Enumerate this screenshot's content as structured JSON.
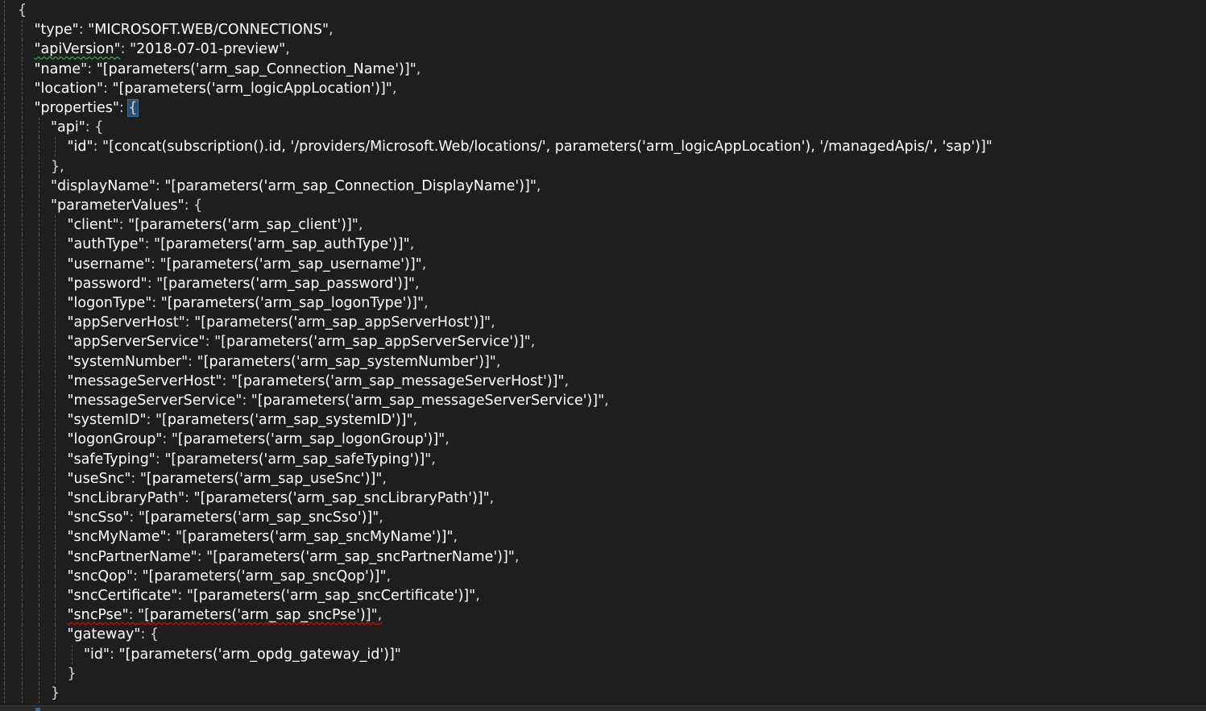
{
  "editor": {
    "lines": [
      {
        "indent": 0,
        "segments": [
          {
            "t": "{",
            "c": "punc"
          }
        ]
      },
      {
        "indent": 1,
        "segments": [
          {
            "t": "\"type\"",
            "c": "key"
          },
          {
            "t": ": ",
            "c": "punc"
          },
          {
            "t": "\"MICROSOFT.WEB/CONNECTIONS\"",
            "c": "str"
          },
          {
            "t": ",",
            "c": "punc"
          }
        ]
      },
      {
        "indent": 1,
        "segments": [
          {
            "t": "\"apiVersion\"",
            "c": "key",
            "sq": "green"
          },
          {
            "t": ": ",
            "c": "punc"
          },
          {
            "t": "\"2018-07-01-preview\"",
            "c": "str"
          },
          {
            "t": ",",
            "c": "punc"
          }
        ]
      },
      {
        "indent": 1,
        "segments": [
          {
            "t": "\"name\"",
            "c": "key"
          },
          {
            "t": ": ",
            "c": "punc"
          },
          {
            "t": "\"[parameters('arm_sap_Connection_Name')]\"",
            "c": "str"
          },
          {
            "t": ",",
            "c": "punc"
          }
        ]
      },
      {
        "indent": 1,
        "segments": [
          {
            "t": "\"location\"",
            "c": "key"
          },
          {
            "t": ": ",
            "c": "punc"
          },
          {
            "t": "\"[parameters('arm_logicAppLocation')]\"",
            "c": "str"
          },
          {
            "t": ",",
            "c": "punc"
          }
        ]
      },
      {
        "indent": 1,
        "segments": [
          {
            "t": "\"properties\"",
            "c": "key"
          },
          {
            "t": ": ",
            "c": "punc"
          },
          {
            "t": "{",
            "c": "punc",
            "hl": true
          }
        ]
      },
      {
        "indent": 2,
        "segments": [
          {
            "t": "\"api\"",
            "c": "key"
          },
          {
            "t": ": {",
            "c": "punc"
          }
        ]
      },
      {
        "indent": 3,
        "segments": [
          {
            "t": "\"id\"",
            "c": "key"
          },
          {
            "t": ": ",
            "c": "punc"
          },
          {
            "t": "\"[concat(subscription().id, '/providers/Microsoft.Web/locations/', parameters('arm_logicAppLocation'), '/managedApis/', 'sap')]\"",
            "c": "str"
          }
        ]
      },
      {
        "indent": 2,
        "segments": [
          {
            "t": "},",
            "c": "punc"
          }
        ]
      },
      {
        "indent": 2,
        "segments": [
          {
            "t": "\"displayName\"",
            "c": "key"
          },
          {
            "t": ": ",
            "c": "punc"
          },
          {
            "t": "\"[parameters('arm_sap_Connection_DisplayName')]\"",
            "c": "str"
          },
          {
            "t": ",",
            "c": "punc"
          }
        ]
      },
      {
        "indent": 2,
        "segments": [
          {
            "t": "\"parameterValues\"",
            "c": "key"
          },
          {
            "t": ": {",
            "c": "punc"
          }
        ]
      },
      {
        "indent": 3,
        "segments": [
          {
            "t": "\"client\"",
            "c": "key"
          },
          {
            "t": ": ",
            "c": "punc"
          },
          {
            "t": "\"[parameters('arm_sap_client')]\"",
            "c": "str"
          },
          {
            "t": ",",
            "c": "punc"
          }
        ]
      },
      {
        "indent": 3,
        "segments": [
          {
            "t": "\"authType\"",
            "c": "key"
          },
          {
            "t": ": ",
            "c": "punc"
          },
          {
            "t": "\"[parameters('arm_sap_authType')]\"",
            "c": "str"
          },
          {
            "t": ",",
            "c": "punc"
          }
        ]
      },
      {
        "indent": 3,
        "segments": [
          {
            "t": "\"username\"",
            "c": "key"
          },
          {
            "t": ": ",
            "c": "punc"
          },
          {
            "t": "\"[parameters('arm_sap_username')]\"",
            "c": "str"
          },
          {
            "t": ",",
            "c": "punc"
          }
        ]
      },
      {
        "indent": 3,
        "segments": [
          {
            "t": "\"password\"",
            "c": "key"
          },
          {
            "t": ": ",
            "c": "punc"
          },
          {
            "t": "\"[parameters('arm_sap_password')]\"",
            "c": "str"
          },
          {
            "t": ",",
            "c": "punc"
          }
        ]
      },
      {
        "indent": 3,
        "segments": [
          {
            "t": "\"logonType\"",
            "c": "key"
          },
          {
            "t": ": ",
            "c": "punc"
          },
          {
            "t": "\"[parameters('arm_sap_logonType')]\"",
            "c": "str"
          },
          {
            "t": ",",
            "c": "punc"
          }
        ]
      },
      {
        "indent": 3,
        "segments": [
          {
            "t": "\"appServerHost\"",
            "c": "key"
          },
          {
            "t": ": ",
            "c": "punc"
          },
          {
            "t": "\"[parameters('arm_sap_appServerHost')]\"",
            "c": "str"
          },
          {
            "t": ",",
            "c": "punc"
          }
        ]
      },
      {
        "indent": 3,
        "segments": [
          {
            "t": "\"appServerService\"",
            "c": "key"
          },
          {
            "t": ": ",
            "c": "punc"
          },
          {
            "t": "\"[parameters('arm_sap_appServerService')]\"",
            "c": "str"
          },
          {
            "t": ",",
            "c": "punc"
          }
        ]
      },
      {
        "indent": 3,
        "segments": [
          {
            "t": "\"systemNumber\"",
            "c": "key"
          },
          {
            "t": ": ",
            "c": "punc"
          },
          {
            "t": "\"[parameters('arm_sap_systemNumber')]\"",
            "c": "str"
          },
          {
            "t": ",",
            "c": "punc"
          }
        ]
      },
      {
        "indent": 3,
        "segments": [
          {
            "t": "\"messageServerHost\"",
            "c": "key"
          },
          {
            "t": ": ",
            "c": "punc"
          },
          {
            "t": "\"[parameters('arm_sap_messageServerHost')]\"",
            "c": "str"
          },
          {
            "t": ",",
            "c": "punc"
          }
        ]
      },
      {
        "indent": 3,
        "segments": [
          {
            "t": "\"messageServerService\"",
            "c": "key"
          },
          {
            "t": ": ",
            "c": "punc"
          },
          {
            "t": "\"[parameters('arm_sap_messageServerService')]\"",
            "c": "str"
          },
          {
            "t": ",",
            "c": "punc"
          }
        ]
      },
      {
        "indent": 3,
        "segments": [
          {
            "t": "\"systemID\"",
            "c": "key"
          },
          {
            "t": ": ",
            "c": "punc"
          },
          {
            "t": "\"[parameters('arm_sap_systemID')]\"",
            "c": "str"
          },
          {
            "t": ",",
            "c": "punc"
          }
        ]
      },
      {
        "indent": 3,
        "segments": [
          {
            "t": "\"logonGroup\"",
            "c": "key"
          },
          {
            "t": ": ",
            "c": "punc"
          },
          {
            "t": "\"[parameters('arm_sap_logonGroup')]\"",
            "c": "str"
          },
          {
            "t": ",",
            "c": "punc"
          }
        ]
      },
      {
        "indent": 3,
        "segments": [
          {
            "t": "\"safeTyping\"",
            "c": "key"
          },
          {
            "t": ": ",
            "c": "punc"
          },
          {
            "t": "\"[parameters('arm_sap_safeTyping')]\"",
            "c": "str"
          },
          {
            "t": ",",
            "c": "punc"
          }
        ]
      },
      {
        "indent": 3,
        "segments": [
          {
            "t": "\"useSnc\"",
            "c": "key"
          },
          {
            "t": ": ",
            "c": "punc"
          },
          {
            "t": "\"[parameters('arm_sap_useSnc')]\"",
            "c": "str"
          },
          {
            "t": ",",
            "c": "punc"
          }
        ]
      },
      {
        "indent": 3,
        "segments": [
          {
            "t": "\"sncLibraryPath\"",
            "c": "key"
          },
          {
            "t": ": ",
            "c": "punc"
          },
          {
            "t": "\"[parameters('arm_sap_sncLibraryPath')]\"",
            "c": "str"
          },
          {
            "t": ",",
            "c": "punc"
          }
        ]
      },
      {
        "indent": 3,
        "segments": [
          {
            "t": "\"sncSso\"",
            "c": "key"
          },
          {
            "t": ": ",
            "c": "punc"
          },
          {
            "t": "\"[parameters('arm_sap_sncSso')]\"",
            "c": "str"
          },
          {
            "t": ",",
            "c": "punc"
          }
        ]
      },
      {
        "indent": 3,
        "segments": [
          {
            "t": "\"sncMyName\"",
            "c": "key"
          },
          {
            "t": ": ",
            "c": "punc"
          },
          {
            "t": "\"[parameters('arm_sap_sncMyName')]\"",
            "c": "str"
          },
          {
            "t": ",",
            "c": "punc"
          }
        ]
      },
      {
        "indent": 3,
        "segments": [
          {
            "t": "\"sncPartnerName\"",
            "c": "key"
          },
          {
            "t": ": ",
            "c": "punc"
          },
          {
            "t": "\"[parameters('arm_sap_sncPartnerName')]\"",
            "c": "str"
          },
          {
            "t": ",",
            "c": "punc"
          }
        ]
      },
      {
        "indent": 3,
        "segments": [
          {
            "t": "\"sncQop\"",
            "c": "key"
          },
          {
            "t": ": ",
            "c": "punc"
          },
          {
            "t": "\"[parameters('arm_sap_sncQop')]\"",
            "c": "str"
          },
          {
            "t": ",",
            "c": "punc"
          }
        ]
      },
      {
        "indent": 3,
        "segments": [
          {
            "t": "\"sncCertificate\"",
            "c": "key"
          },
          {
            "t": ": ",
            "c": "punc"
          },
          {
            "t": "\"[parameters('arm_sap_sncCertificate')]\"",
            "c": "str"
          },
          {
            "t": ",",
            "c": "punc"
          }
        ]
      },
      {
        "indent": 3,
        "sq": "red",
        "segments": [
          {
            "t": "\"sncPse\"",
            "c": "key"
          },
          {
            "t": ": ",
            "c": "punc"
          },
          {
            "t": "\"[parameters('arm_sap_sncPse')]\"",
            "c": "str"
          },
          {
            "t": ",",
            "c": "punc"
          }
        ]
      },
      {
        "indent": 3,
        "segments": [
          {
            "t": "\"gateway\"",
            "c": "key"
          },
          {
            "t": ": {",
            "c": "punc"
          }
        ]
      },
      {
        "indent": 4,
        "segments": [
          {
            "t": "\"id\"",
            "c": "key"
          },
          {
            "t": ": ",
            "c": "punc"
          },
          {
            "t": "\"[parameters('arm_opdg_gateway_id')]\"",
            "c": "str"
          }
        ]
      },
      {
        "indent": 3,
        "segments": [
          {
            "t": "}",
            "c": "punc"
          }
        ]
      },
      {
        "indent": 2,
        "segments": [
          {
            "t": "}",
            "c": "punc"
          }
        ]
      }
    ]
  }
}
